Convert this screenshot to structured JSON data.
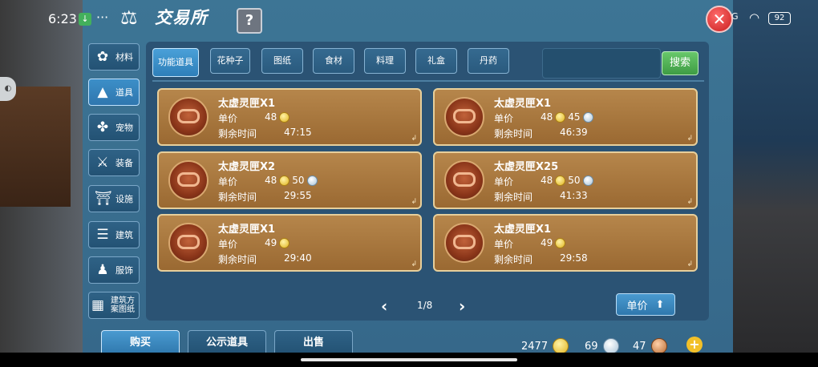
{
  "status": {
    "time": "6:23",
    "dots": "···",
    "signal": "5G",
    "wifi": "WiFi",
    "battery": "92"
  },
  "header": {
    "title": "交易所",
    "help": "?"
  },
  "sidebar": {
    "items": [
      {
        "label": "材料"
      },
      {
        "label": "道具"
      },
      {
        "label": "宠物"
      },
      {
        "label": "装备"
      },
      {
        "label": "设施"
      },
      {
        "label": "建筑"
      },
      {
        "label": "服饰"
      },
      {
        "label": "建筑方案图纸"
      }
    ]
  },
  "tabs": [
    {
      "label": "功能道具"
    },
    {
      "label": "花种子"
    },
    {
      "label": "图纸"
    },
    {
      "label": "食材"
    },
    {
      "label": "料理"
    },
    {
      "label": "礼盒"
    },
    {
      "label": "丹药"
    }
  ],
  "search": {
    "button": "搜索",
    "value": ""
  },
  "labels": {
    "unit_price": "单价",
    "remaining": "剩余时间"
  },
  "listings": [
    {
      "name": "太虚灵匣X1",
      "gold": "48",
      "silver": "",
      "time": "47:15"
    },
    {
      "name": "太虚灵匣X1",
      "gold": "48",
      "silver": "45",
      "time": "46:39"
    },
    {
      "name": "太虚灵匣X2",
      "gold": "48",
      "silver": "50",
      "time": "29:55"
    },
    {
      "name": "太虚灵匣X25",
      "gold": "48",
      "silver": "50",
      "time": "41:33"
    },
    {
      "name": "太虚灵匣X1",
      "gold": "49",
      "silver": "",
      "time": "29:40"
    },
    {
      "name": "太虚灵匣X1",
      "gold": "49",
      "silver": "",
      "time": "29:58"
    }
  ],
  "pager": {
    "page": "1/8"
  },
  "sort_button": "单价",
  "bottom_tabs": [
    {
      "label": "购买"
    },
    {
      "label": "公示道具"
    },
    {
      "label": "出售"
    }
  ],
  "currency": {
    "gold": "2477",
    "silver": "69",
    "bronze": "47"
  }
}
